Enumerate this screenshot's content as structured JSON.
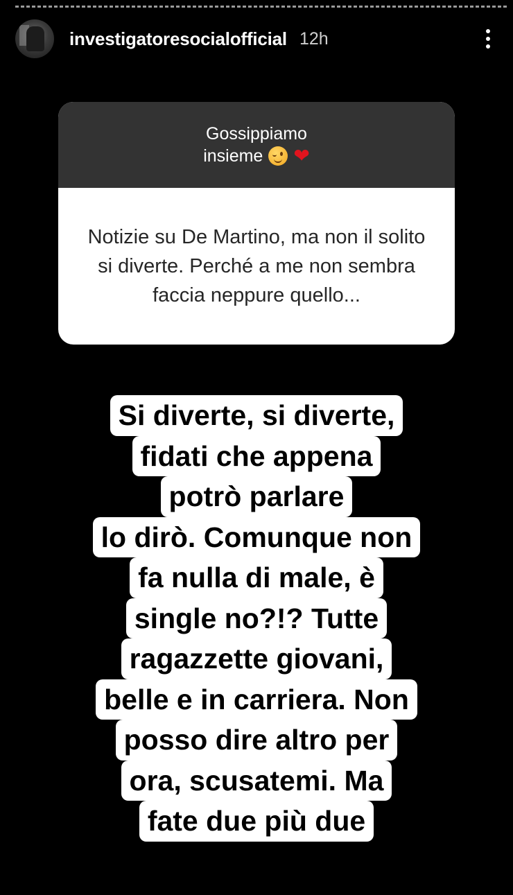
{
  "story": {
    "progress_segments": 7,
    "current_segment": 0,
    "username": "investigatoresocialofficial",
    "time_ago": "12h",
    "menu_icon": "more-vertical-icon"
  },
  "question_sticker": {
    "prompt_line1": "Gossippiamo",
    "prompt_line2": "insieme",
    "prompt_emojis": [
      "winking-face-emoji",
      "red-heart-emoji"
    ],
    "question": "Notizie su De Martino, ma non il solito si diverte. Perché a me non sembra faccia neppure quello...",
    "header_color": "#333333"
  },
  "answer": {
    "lines": [
      "Si diverte, si diverte,",
      "fidati che appena",
      "potrò parlare",
      "lo dirò. Comunque non",
      "fa nulla di male, è",
      "single no?!? Tutte",
      "ragazzette giovani,",
      "belle e in carriera. Non",
      "posso dire altro per",
      "ora, scusatemi. Ma",
      "fate due più due"
    ]
  }
}
